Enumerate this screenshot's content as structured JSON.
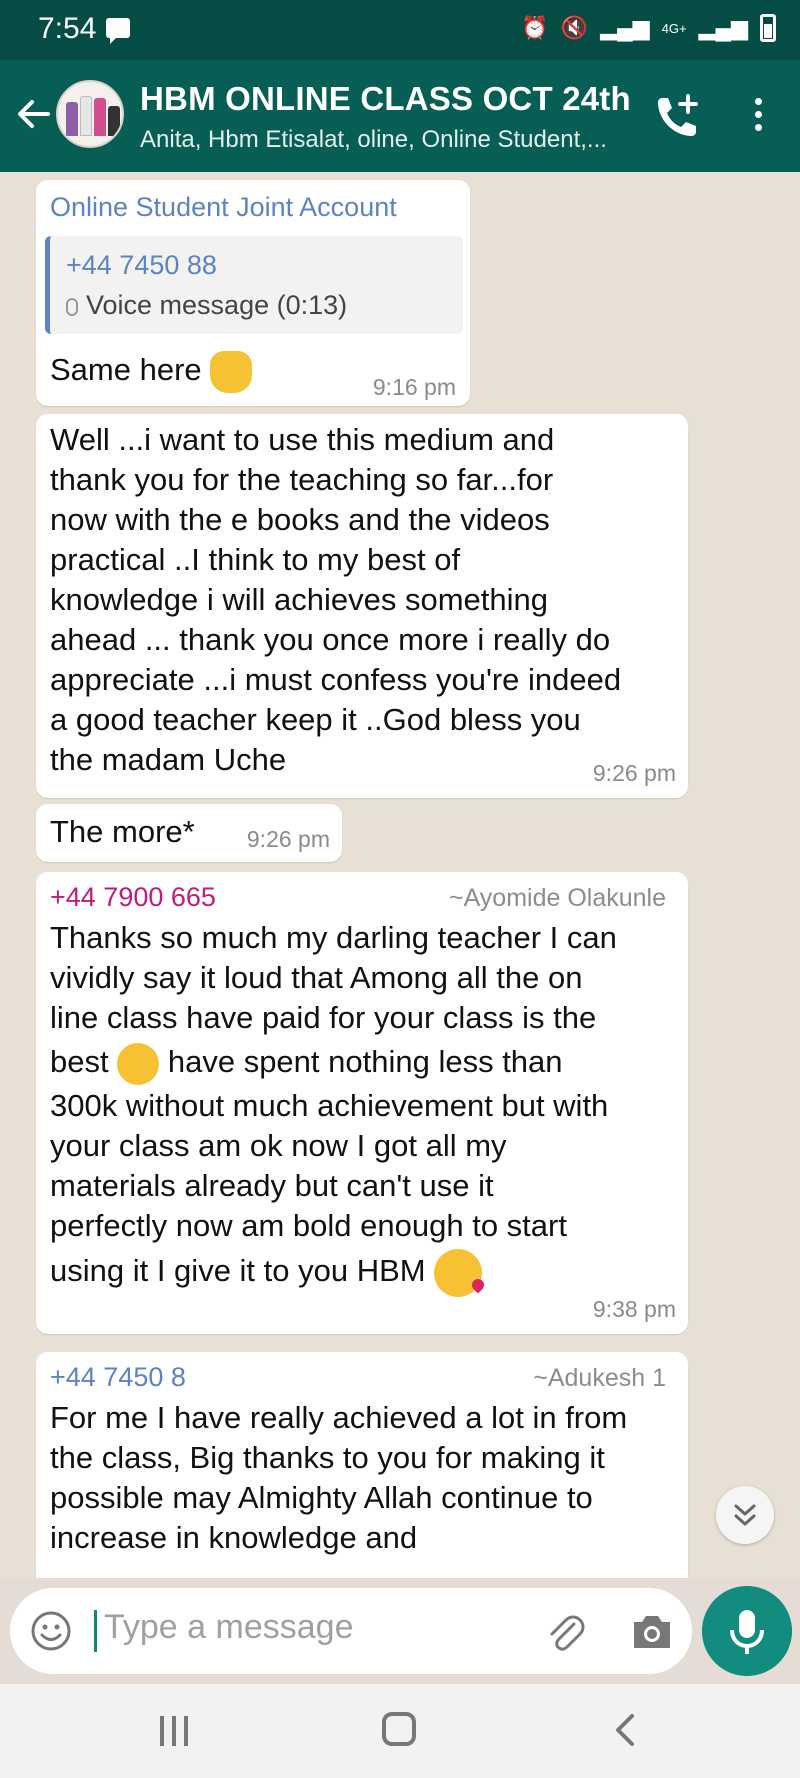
{
  "status_bar": {
    "time": "7:54",
    "network_label": "4G+"
  },
  "header": {
    "title": "HBM ONLINE CLASS OCT 24th",
    "members": "Anita, Hbm Etisalat, oline, Online Student,..."
  },
  "messages": [
    {
      "sender": "Online Student Joint Account",
      "quote_phone": "+44 7450 88",
      "quote_content": "Voice message (0:13)",
      "text": "Same here",
      "time": "9:16 pm"
    },
    {
      "lines": [
        "Well ...i want to use this medium and",
        "thank you for the teaching so far...for",
        "now with the e books and the videos",
        "practical ..I think to my best of",
        "knowledge i will achieves something",
        "ahead ... thank you once more i really do",
        "appreciate ...i must confess you're indeed",
        "a good teacher keep it ..God bless you",
        "the madam Uche"
      ],
      "time": "9:26 pm"
    },
    {
      "text": "The more*",
      "time": "9:26 pm"
    },
    {
      "sender_phone": "+44 7900 665",
      "sender_name": "~Ayomide Olakunle",
      "lines": [
        "Thanks so much my darling teacher I can",
        "vividly say it loud that Among all the on",
        "line class have paid for your class is the",
        "best",
        "have spent nothing less than",
        "300k without much achievement but with",
        "your class am ok now I got all my",
        "materials already but can't use it",
        "perfectly now am bold enough to start",
        "using it I give it to you HBM"
      ],
      "time": "9:38 pm"
    },
    {
      "sender_phone": "+44 7450 8",
      "sender_name": "~Adukesh 1",
      "lines": [
        "For me I have really achieved a lot in from",
        "the class, Big thanks to you for making it",
        "possible may Almighty Allah continue to",
        "increase in knowledge and"
      ]
    }
  ],
  "composer": {
    "placeholder": "Type a message"
  },
  "colors": {
    "header": "#075e54",
    "status_bar": "#054d44",
    "accent": "#128c7e",
    "sender_blue": "#5c84c0",
    "sender_pink": "#c11c7b"
  },
  "icons": [
    "back-arrow-icon",
    "call-add-icon",
    "more-vert-icon",
    "chevron-double-down-icon",
    "smiley-icon",
    "paperclip-icon",
    "camera-icon",
    "mic-icon"
  ]
}
